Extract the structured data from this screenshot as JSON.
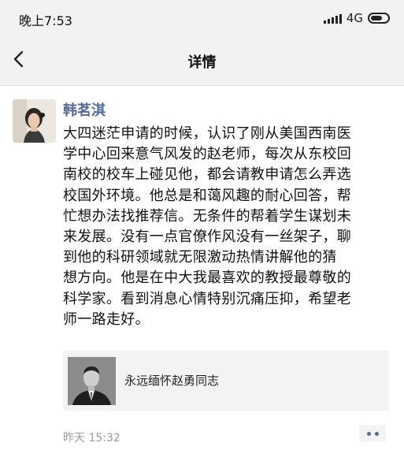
{
  "status_bar": {
    "time": "晚上7:53",
    "network": "4G",
    "network_sub": "ᵢₗ",
    "battery_level": 0.7
  },
  "nav": {
    "title": "详情",
    "back_icon": "chevron-left-icon"
  },
  "post": {
    "author": "韩茗淇",
    "body": "大四迷茫申请的时候，认识了刚从美国西南医\n学中心回来意气风发的赵老师，每次从东校回\n南校的校车上碰见他，都会请教申请怎么弄选\n校国外环境。他总是和蔼风趣的耐心回答，帮\n忙想办法找推荐信。无条件的帮着学生谋划未\n来发展。没有一点官僚作风没有一丝架子，聊\n到他的科研领域就无限激动热情讲解他的猜\n想方向。他是在中大我最喜欢的教授最尊敬的\n科学家。看到消息心情特别沉痛压抑，希望老\n师一路走好。",
    "link_card": {
      "title": "永远缅怀赵勇同志"
    },
    "timestamp": "昨天 15:32",
    "more_icon": "more-dots-icon"
  },
  "colors": {
    "accent": "#566b94",
    "header_bg": "#f2f2f2",
    "card_bg": "#f3f3f5",
    "timestamp": "#9b9b9b"
  }
}
